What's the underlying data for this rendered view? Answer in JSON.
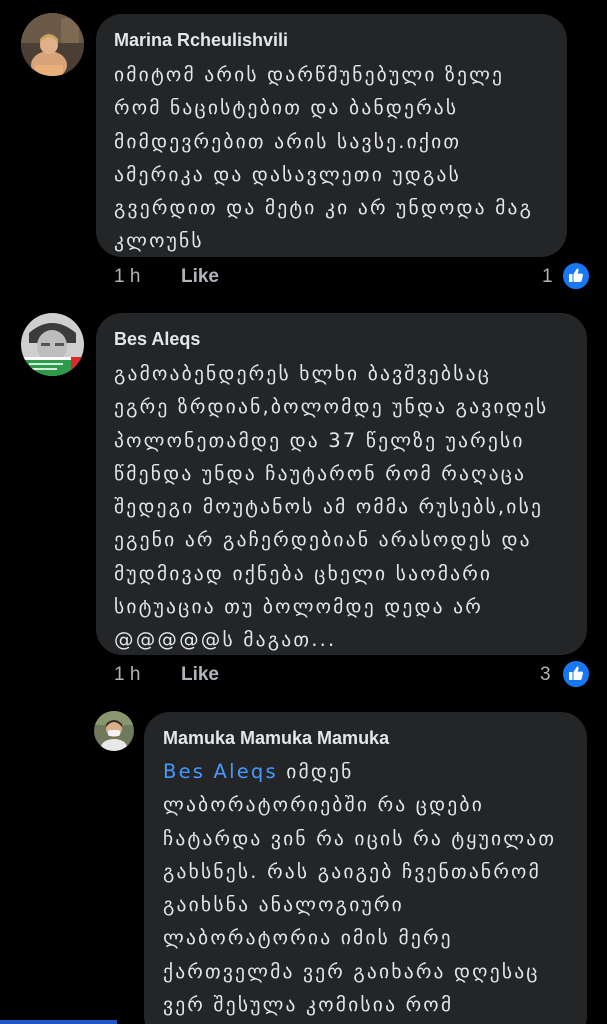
{
  "colors": {
    "background": "#000000",
    "bubble": "#242526",
    "text_primary": "#e4e6eb",
    "text_secondary": "#b0b3b8",
    "mention": "#4599ff",
    "like_blue": "#1877f2"
  },
  "comments": [
    {
      "author": "Marina Rcheulishvili",
      "lines": [
        "იმიტომ არის დარწმუნებული ზელე",
        "რომ ნაცისტებით და ბანდერას",
        "მიმდევრებით არის სავსე.იქით",
        "ამერიკა და დასავლეთი უდგას",
        "გვერდით და მეტი კი არ უნდოდა მაგ",
        "კლოუნს"
      ],
      "time": "1 h",
      "like_label": "Like",
      "reaction_count": "1",
      "reaction_icon": "thumbs-up-icon"
    },
    {
      "author": "Bes Aleqs",
      "lines": [
        "გამოაბენდერეს ხლხი ბავშვებსაც",
        "ეგრე ზრდიან,ბოლომდე უნდა გავიდეს",
        "პოლონეთამდე და 37 წელზე უარესი",
        "წმენდა უნდა ჩაუტარონ რომ რაღაცა",
        "შედეგი მოუტანოს ამ ომმა რუსებს,ისე",
        "ეგენი არ გაჩერდებიან არასოდეს და",
        "მუდმივად იქნება ცხელი საომარი",
        "სიტუაცია თუ ბოლომდე დედა არ",
        "@@@@@ს მაგათ..."
      ],
      "time": "1 h",
      "like_label": "Like",
      "reaction_count": "3",
      "reaction_icon": "thumbs-up-icon"
    }
  ],
  "reply": {
    "author": "Mamuka Mamuka Mamuka",
    "mention": "Bes Aleqs",
    "first_line_rest": " იმდენ",
    "lines": [
      "ლაბორატორიებში რა ცდები",
      "ჩატარდა ვინ რა იცის რა ტყუილათ",
      "გახსნეს. რას გაიგებ ჩვენთანრომ",
      "გაიხსნა ანალოგიური",
      "ლაბორატორია იმის მერე",
      "ქართველმა ვერ გაიხარა დღესაც",
      "ვერ შესულა კომისია რომ"
    ]
  }
}
